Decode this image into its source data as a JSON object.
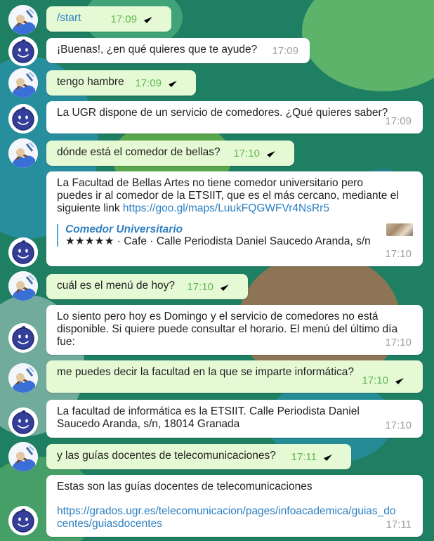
{
  "colors": {
    "background": "#1e7f63",
    "outgoing_bubble": "#e6f9d5",
    "incoming_bubble": "#ffffff",
    "outgoing_meta": "#5fb84f",
    "incoming_meta": "#9aa0a6",
    "link": "#2b7fc2"
  },
  "messages": [
    {
      "from": "user",
      "text": "/start",
      "time": "17:09",
      "status_icon": "double-check-icon"
    },
    {
      "from": "bot",
      "text": "¡Buenas!, ¿en qué quieres que te ayude?",
      "time": "17:09"
    },
    {
      "from": "user",
      "text": "tengo hambre",
      "time": "17:09",
      "status_icon": "double-check-icon"
    },
    {
      "from": "bot",
      "text": "La UGR dispone de un servicio de comedores. ¿Qué quieres saber?",
      "time": "17:09"
    },
    {
      "from": "user",
      "text": "dónde está el comedor de bellas?",
      "time": "17:10",
      "status_icon": "double-check-icon"
    },
    {
      "from": "bot",
      "text_line1": "La Facultad de Bellas Artes no tiene comedor universitario pero",
      "text_line2": "puedes ir al comedor de la ETSIIT, que es el más cercano, mediante el",
      "text_line3": "siguiente link ",
      "link": "https://goo.gl/maps/LuukFQGWFVr4NsRr5",
      "preview_title": "Comedor Universitario",
      "preview_desc": "★★★★★ · Cafe · Calle Periodista Daniel Saucedo Aranda, s/n",
      "time": "17:10"
    },
    {
      "from": "user",
      "text": "cuál es el menú de hoy?",
      "time": "17:10",
      "status_icon": "double-check-icon"
    },
    {
      "from": "bot",
      "text_line1": "Lo siento pero hoy es Domingo y el servicio de comedores no está",
      "text_line2": "disponible. Si quiere puede consultar el horario. El menú  del último día",
      "text_line3": "fue:",
      "time": "17:10"
    },
    {
      "from": "user",
      "text": "me puedes decir la facultad en la que se imparte informática?",
      "time": "17:10",
      "status_icon": "double-check-icon"
    },
    {
      "from": "bot",
      "text_line1": "La facultad de informática es la ETSIIT. Calle Periodista Daniel",
      "text_line2": "Saucedo Aranda, s/n, 18014 Granada",
      "time": "17:10"
    },
    {
      "from": "user",
      "text": "y las guías docentes de telecomunicaciones?",
      "time": "17:11",
      "status_icon": "double-check-icon"
    },
    {
      "from": "bot",
      "text_line1": "Estas son las guías docentes de telecomunicaciones",
      "link_line1": "https://grados.ugr.es/telecomunicacion/pages/infoacademica/guias_do",
      "link_line2": "centes/guiasdocentes",
      "time": "17:11"
    }
  ]
}
